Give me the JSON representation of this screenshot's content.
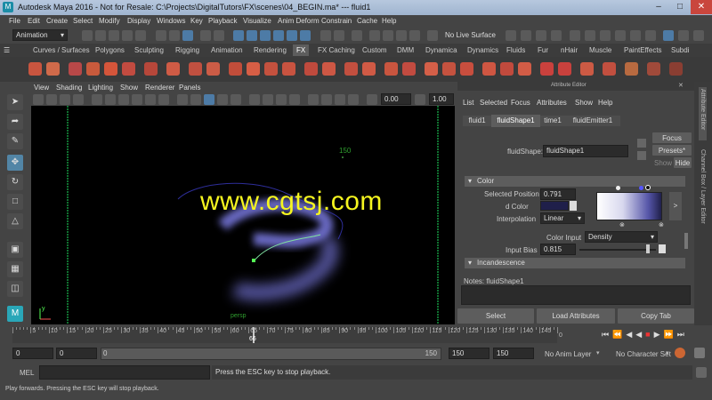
{
  "window": {
    "title": "Autodesk Maya 2016 - Not for Resale: C:\\Projects\\DigitalTutors\\FX\\scenes\\04_BEGIN.ma*   ---   fluid1",
    "logo": "M"
  },
  "menubar": [
    "File",
    "Edit",
    "Create",
    "Select",
    "Modify",
    "Display",
    "Windows",
    "Key",
    "Playback",
    "Visualize",
    "Anim Deform",
    "Constrain",
    "Cache",
    "Help"
  ],
  "toolbar": {
    "mode_select": "Animation",
    "live_surface": "No Live Surface"
  },
  "shelf_tabs": [
    "Curves / Surfaces",
    "Polygons",
    "Sculpting",
    "Rigging",
    "Animation",
    "Rendering",
    "FX",
    "FX Caching",
    "Custom",
    "DMM",
    "Dynamica",
    "Dynamics",
    "Fluids",
    "Fur",
    "nHair",
    "Muscle",
    "PaintEffects",
    "Subdi"
  ],
  "shelf_active": "FX",
  "viewport": {
    "menu": [
      "View",
      "Shading",
      "Lighting",
      "Show",
      "Renderer",
      "Panels"
    ],
    "field_a": "0.00",
    "field_b": "1.00",
    "frame_label": "150",
    "camera_label": "persp",
    "axis_label": "y"
  },
  "watermark": "www.cgtsj.com",
  "attribute_editor": {
    "header": "Attribute Editor",
    "menu": [
      "List",
      "Selected",
      "Focus",
      "Attributes",
      "Show",
      "Help"
    ],
    "tabs": [
      "fluid1",
      "fluidShape1",
      "time1",
      "fluidEmitter1"
    ],
    "active_tab": "fluidShape1",
    "node_label": "fluidShape:",
    "node_value": "fluidShape1",
    "focus_btn": "Focus",
    "presets_btn": "Presets*",
    "show_btn": "Show",
    "hide_btn": "Hide",
    "color_section": "Color",
    "selected_position_label": "Selected Position",
    "selected_position_value": "0.791",
    "selected_color_label": "d Color",
    "interpolation_label": "Interpolation",
    "interpolation_value": "Linear",
    "color_input_label": "Color Input",
    "color_input_value": "Density",
    "input_bias_label": "Input Bias",
    "input_bias_value": "0.815",
    "incandescence_section": "Incandescence",
    "notes_label": "Notes: fluidShape1",
    "select_btn": "Select",
    "load_btn": "Load Attributes",
    "copy_btn": "Copy Tab",
    "side_tab_1": "Attribute Editor",
    "side_tab_2": "Channel Box / Layer Editor"
  },
  "timeline": {
    "ticks": [
      "5",
      "10",
      "15",
      "20",
      "25",
      "30",
      "35",
      "40",
      "45",
      "50",
      "55",
      "60",
      "65",
      "70",
      "75",
      "80",
      "85",
      "90",
      "95",
      "100",
      "105",
      "110",
      "115",
      "120",
      "125",
      "130",
      "135",
      "140",
      "145"
    ],
    "current_frame": "66",
    "current_frame_field": "0"
  },
  "range": {
    "start": "0",
    "anim_start": "0",
    "slider_start": "0",
    "slider_end": "150",
    "anim_end": "150",
    "end": "150",
    "anim_layer": "No Anim Layer",
    "char_set": "No Character Set"
  },
  "mel": {
    "label": "MEL",
    "message": "Press the ESC key to stop playback."
  },
  "helpline": "Play forwards. Pressing the ESC key will stop playback.",
  "colors": {
    "fluid": "#8a8aff",
    "accent": "#5285a6",
    "watermark": "#f5f51f"
  }
}
